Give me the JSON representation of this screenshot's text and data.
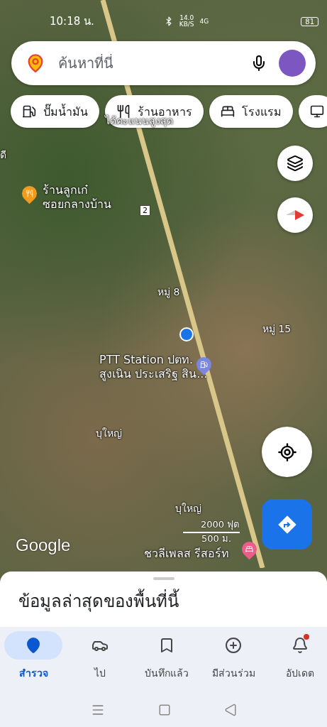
{
  "status_bar": {
    "time": "10:18 น.",
    "speed": "14.0",
    "speed_unit": "KB/S",
    "network": "4G",
    "battery": "81"
  },
  "search": {
    "placeholder": "ค้นหาที่นี่"
  },
  "chips": [
    {
      "kind": "fuel",
      "label": "ปั๊มน้ำมัน"
    },
    {
      "kind": "food",
      "label": "ร้านอาหาร"
    },
    {
      "kind": "hotel",
      "label": "โรงแรม"
    },
    {
      "kind": "more"
    }
  ],
  "map": {
    "labels": [
      {
        "kind": "text",
        "lines": [
          "ได้คะแนนสูงสุด"
        ]
      },
      {
        "kind": "text",
        "lines": [
          "ดี"
        ]
      },
      {
        "kind": "food",
        "color": "#f29b1d",
        "lines": [
          "ร้านลูกเก๋",
          "ซอยกลางบ้าน"
        ]
      },
      {
        "kind": "shield",
        "lines": [
          "2"
        ]
      },
      {
        "kind": "text",
        "lines": [
          "หมู่ 8"
        ]
      },
      {
        "kind": "text",
        "lines": [
          "หมู่ 15"
        ]
      },
      {
        "kind": "fuel",
        "color": "#7b86e0",
        "lines": [
          "PTT Station ปตท.",
          "สูงเนิน ประเสริฐ สิน..."
        ]
      },
      {
        "kind": "text",
        "lines": [
          "บุใหญ่"
        ]
      },
      {
        "kind": "text",
        "lines": [
          "บุใหญ่"
        ]
      },
      {
        "kind": "hotel",
        "color": "#ec5d8a",
        "lines": [
          "ชวลีเพลส รีสอร์ท"
        ]
      }
    ],
    "scale": {
      "imperial": "2000 ฟุต",
      "metric": "500 ม."
    },
    "logo": "Google"
  },
  "sheet": {
    "title": "ข้อมูลล่าสุดของพื้นที่นี้"
  },
  "nav": [
    {
      "kind": "explore",
      "label": "สำรวจ",
      "selected": true,
      "badge": false
    },
    {
      "kind": "go",
      "label": "ไป",
      "selected": false,
      "badge": false
    },
    {
      "kind": "saved",
      "label": "บันทึกแล้ว",
      "selected": false,
      "badge": false
    },
    {
      "kind": "contribute",
      "label": "มีส่วนร่วม",
      "selected": false,
      "badge": false
    },
    {
      "kind": "updates",
      "label": "อัปเดต",
      "selected": false,
      "badge": true
    }
  ]
}
